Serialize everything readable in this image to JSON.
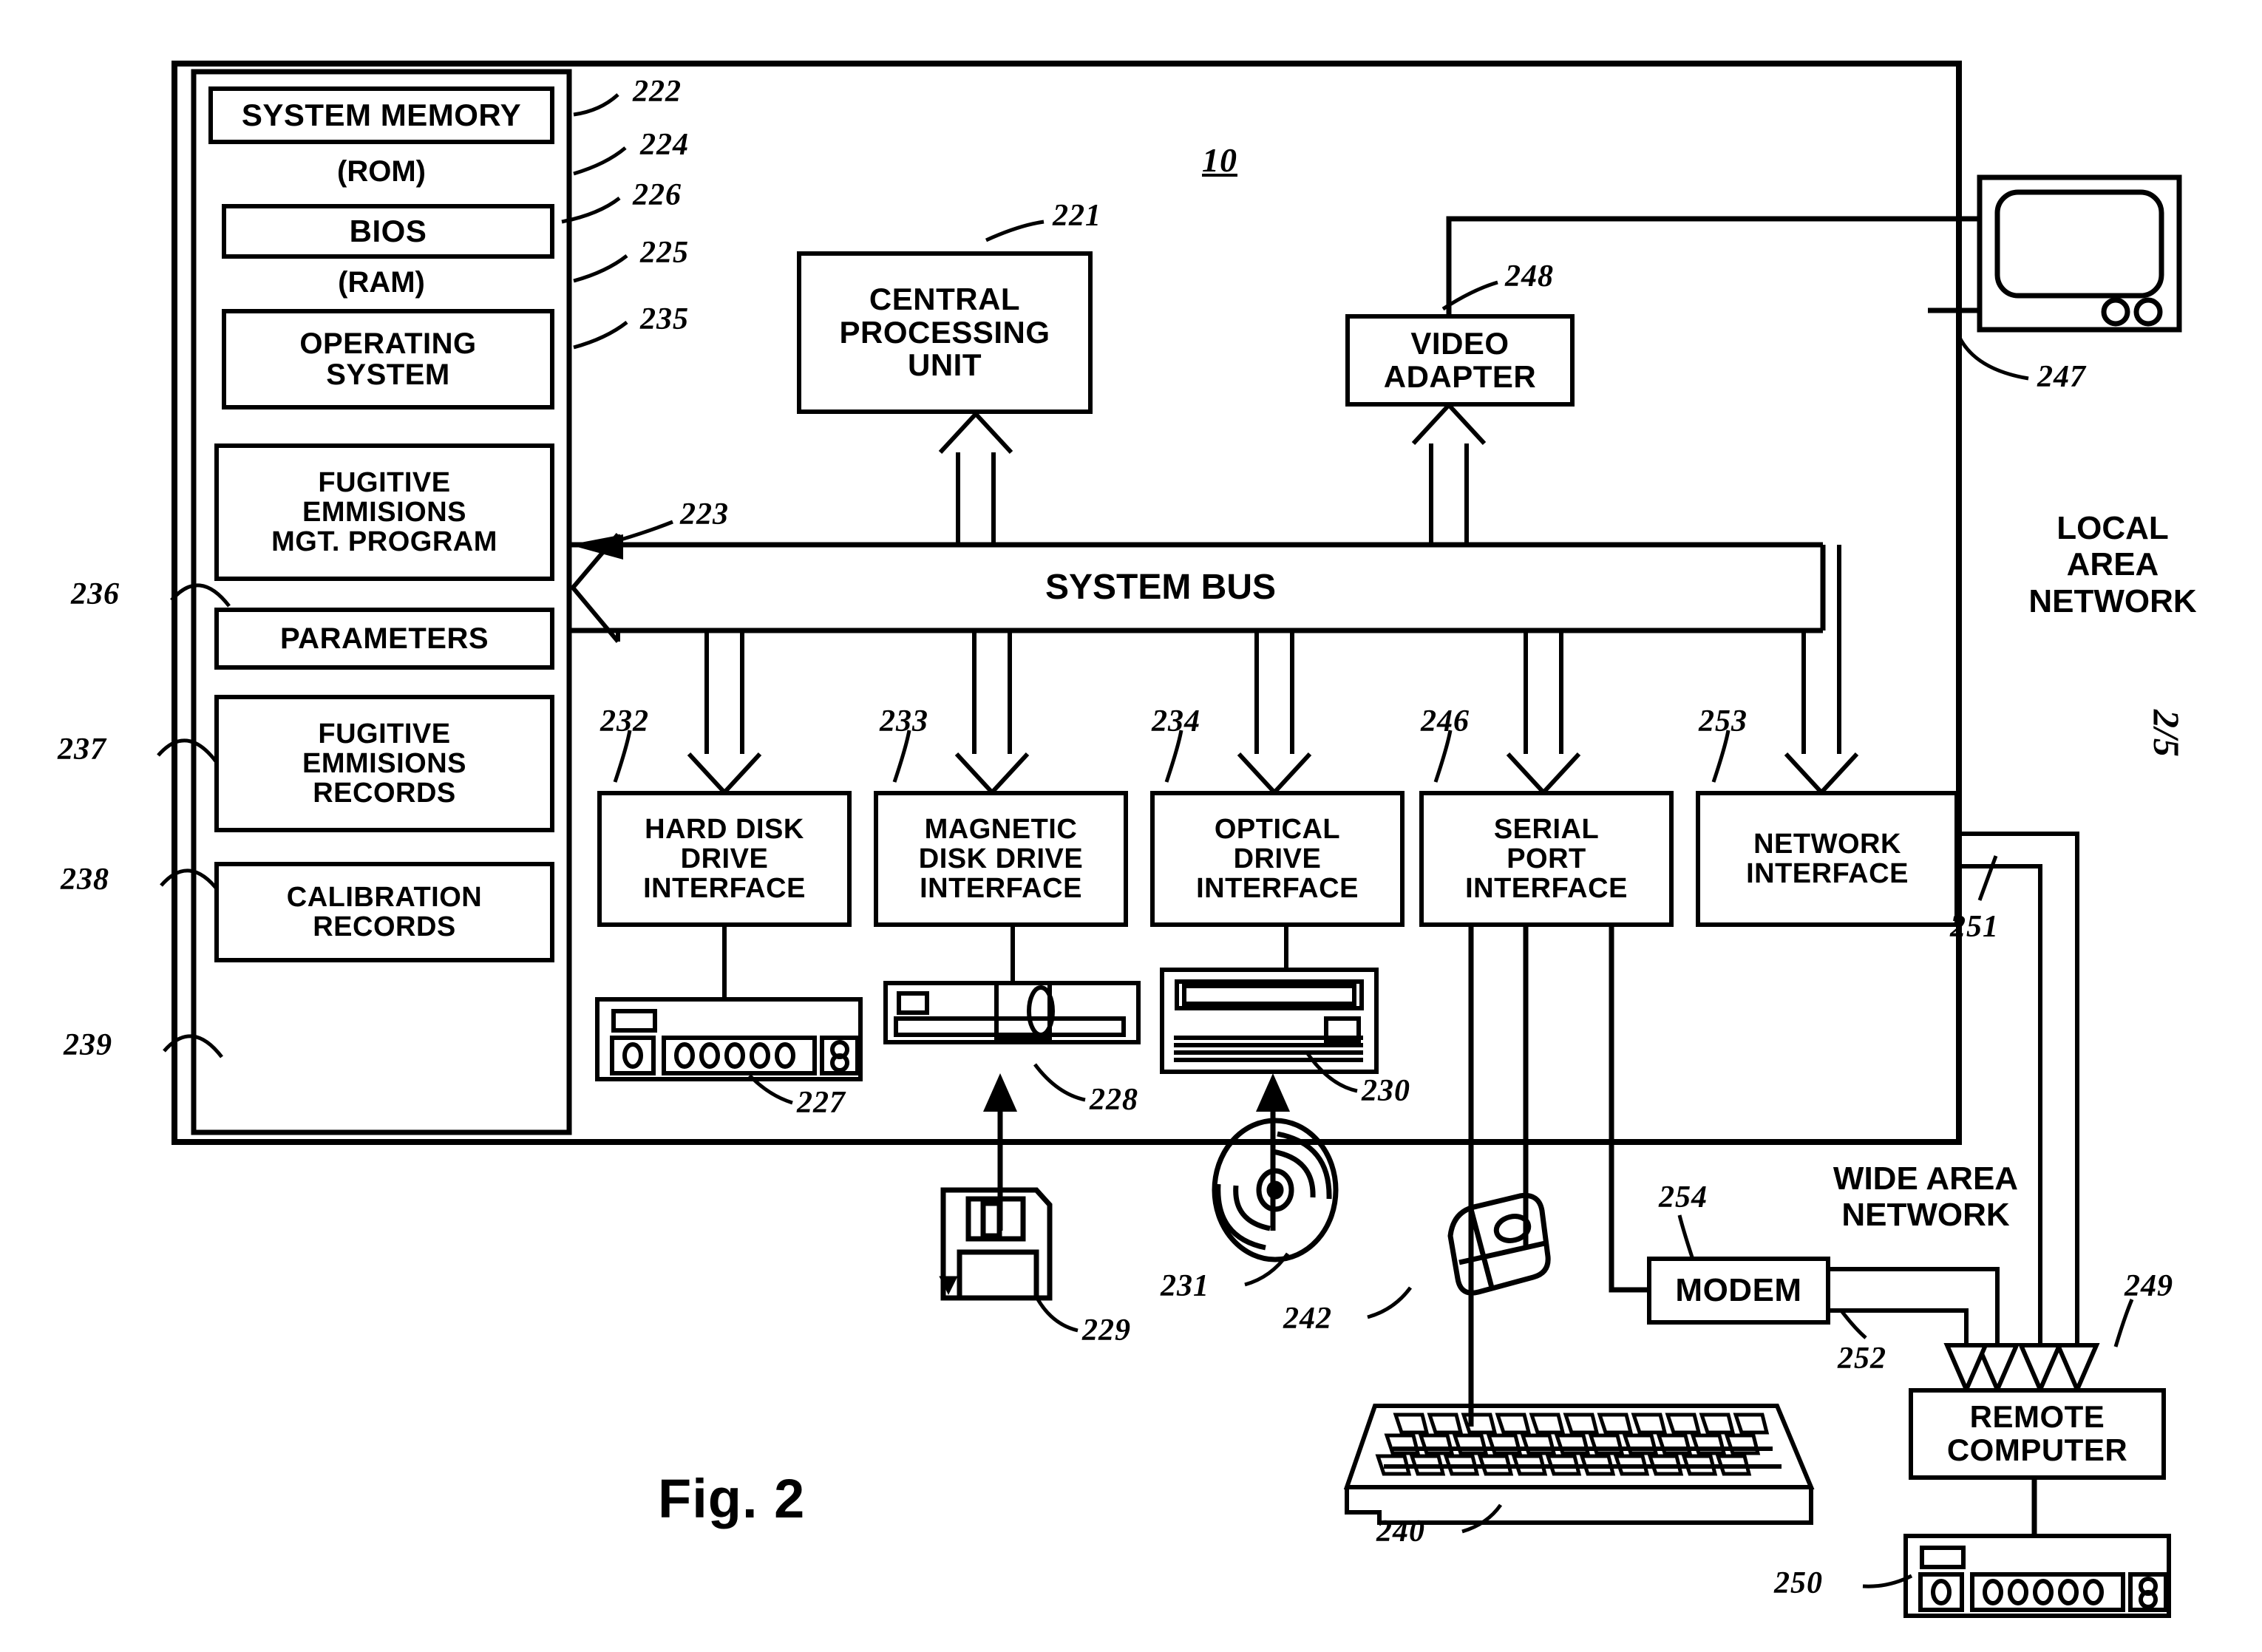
{
  "figure": {
    "caption": "Fig. 2",
    "sheet_number": "2/5",
    "system_ref": "10"
  },
  "memory": {
    "title": "SYSTEM MEMORY",
    "title_ref": "222",
    "rom_label": "(ROM)",
    "rom_ref": "224",
    "bios_label": "BIOS",
    "bios_ref": "226",
    "ram_label": "(RAM)",
    "ram_ref": "225",
    "items": [
      {
        "label": "OPERATING\nSYSTEM",
        "ref": "235"
      },
      {
        "label": "FUGITIVE\nEMMISIONS\nMGT.   PROGRAM",
        "ref": "236"
      },
      {
        "label": "PARAMETERS",
        "ref": "237"
      },
      {
        "label": "FUGITIVE\nEMMISIONS\nRECORDS",
        "ref": "238"
      },
      {
        "label": "CALIBRATION\nRECORDS",
        "ref": "239"
      }
    ]
  },
  "cpu": {
    "label": "CENTRAL\nPROCESSING\nUNIT",
    "ref": "221"
  },
  "video_adapter": {
    "label": "VIDEO\nADAPTER",
    "ref": "248"
  },
  "monitor": {
    "ref": "247",
    "name": "monitor"
  },
  "bus": {
    "label": "SYSTEM BUS",
    "ref": "223"
  },
  "interfaces": [
    {
      "label": "HARD  DISK\nDRIVE\nINTERFACE",
      "ref": "232"
    },
    {
      "label": "MAGNETIC\nDISK DRIVE\nINTERFACE",
      "ref": "233"
    },
    {
      "label": "OPTICAL\nDRIVE\nINTERFACE",
      "ref": "234"
    },
    {
      "label": "SERIAL\nPORT\nINTERFACE",
      "ref": "246"
    },
    {
      "label": "NETWORK\nINTERFACE",
      "ref": "253"
    }
  ],
  "drives": [
    {
      "name": "hard-disk-drive",
      "ref": "227"
    },
    {
      "name": "magnetic-disk-drive",
      "ref": "228"
    },
    {
      "name": "optical-drive",
      "ref": "230"
    }
  ],
  "media": [
    {
      "name": "floppy-disk",
      "ref": "229"
    },
    {
      "name": "optical-disc",
      "ref": "231"
    },
    {
      "name": "mouse",
      "ref": "242"
    },
    {
      "name": "keyboard",
      "ref": "240"
    }
  ],
  "networks": {
    "lan_label": "LOCAL\nAREA\nNETWORK",
    "lan_link_ref": "251",
    "wan_label": "WIDE AREA\nNETWORK",
    "wan_link_ref": "252"
  },
  "modem": {
    "label": "MODEM",
    "ref": "254"
  },
  "remote_computer": {
    "label": "REMOTE\nCOMPUTER",
    "ref": "249"
  },
  "remote_drive": {
    "name": "remote-hard-disk-drive",
    "ref": "250"
  }
}
